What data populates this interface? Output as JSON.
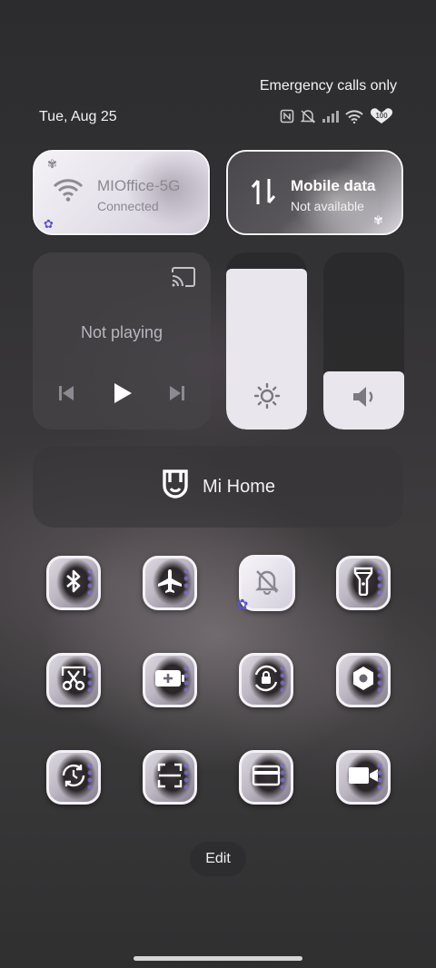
{
  "status_bar": {
    "carrier_text": "Emergency calls only",
    "date": "Tue, Aug 25",
    "battery": "100",
    "icons": [
      "nfc-icon",
      "mute-icon",
      "signal-icon",
      "wifi-icon",
      "battery-icon"
    ]
  },
  "wifi_tile": {
    "name": "MIOffice-5G",
    "status": "Connected",
    "icon": "wifi-icon"
  },
  "mobile_tile": {
    "name": "Mobile data",
    "status": "Not available",
    "icon": "data-arrows-icon"
  },
  "media": {
    "status": "Not playing",
    "icons": [
      "cast-icon",
      "previous-icon",
      "play-icon",
      "next-icon"
    ]
  },
  "sliders": {
    "brightness": {
      "level": 0.91,
      "icon": "sun-icon"
    },
    "volume": {
      "level": 0.33,
      "icon": "speaker-icon"
    }
  },
  "mi_home": {
    "label": "Mi Home",
    "icon": "mi-home-icon"
  },
  "toggles": [
    {
      "name": "bluetooth",
      "icon": "bluetooth-icon",
      "active": false
    },
    {
      "name": "airplane-mode",
      "icon": "airplane-icon",
      "active": false
    },
    {
      "name": "mute",
      "icon": "bell-off-icon",
      "active": true
    },
    {
      "name": "flashlight",
      "icon": "flashlight-icon",
      "active": false
    },
    {
      "name": "screenshot",
      "icon": "scissors-icon",
      "active": false
    },
    {
      "name": "battery-saver",
      "icon": "battery-plus-icon",
      "active": false
    },
    {
      "name": "rotation-lock",
      "icon": "rotation-lock-icon",
      "active": false
    },
    {
      "name": "location",
      "icon": "location-icon",
      "active": false
    },
    {
      "name": "sync",
      "icon": "sync-icon",
      "active": false
    },
    {
      "name": "scanner",
      "icon": "scan-icon",
      "active": false
    },
    {
      "name": "cards",
      "icon": "card-icon",
      "active": false
    },
    {
      "name": "screen-recorder",
      "icon": "video-icon",
      "active": false
    }
  ],
  "edit_label": "Edit",
  "colors": {
    "tile_light": "#f4f2f6",
    "accent_flower": "#5a55c8",
    "slider_fill": "#e9e7ed"
  }
}
